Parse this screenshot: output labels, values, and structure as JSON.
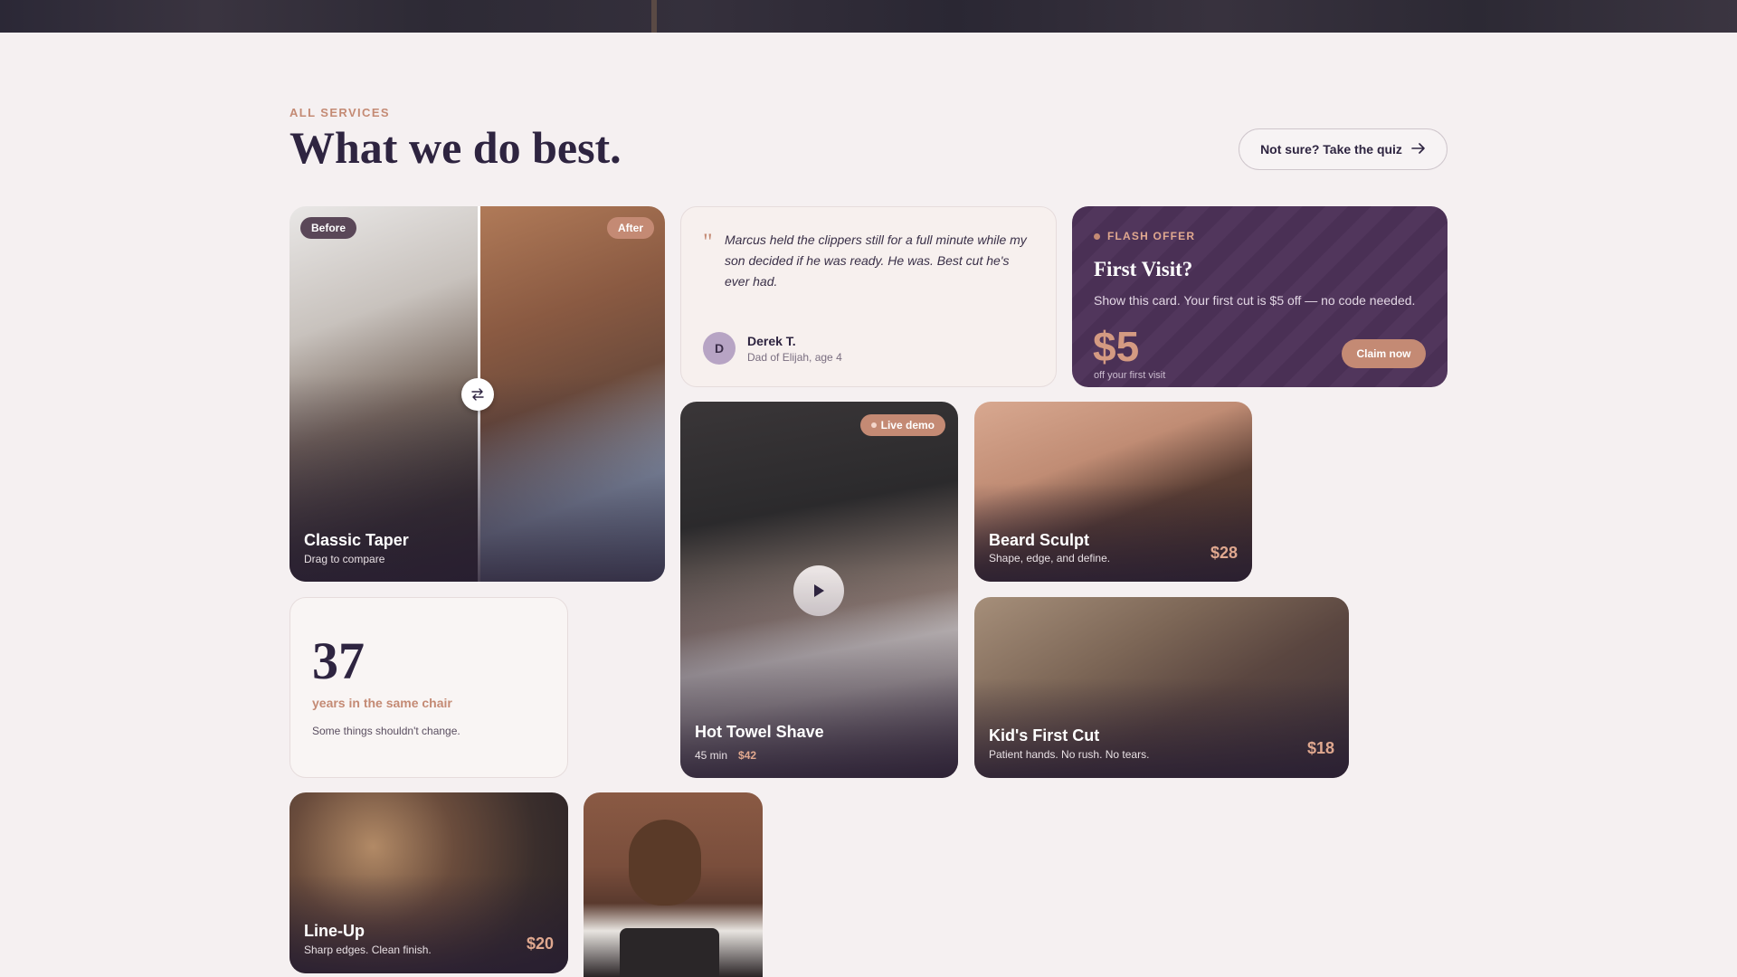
{
  "section": {
    "eyebrow": "ALL SERVICES",
    "title": "What we do best.",
    "quiz_button": "Not sure? Take the quiz",
    "quiz_icon": "arrow-right-icon"
  },
  "classic_taper": {
    "before_label": "Before",
    "after_label": "After",
    "title": "Classic Taper",
    "subtitle": "Drag to compare",
    "handle_icon": "swap-arrows-icon"
  },
  "testimonial": {
    "quote": "Marcus held the clippers still for a full minute while my son decided if he was ready. He was. Best cut he's ever had.",
    "avatar_initial": "D",
    "name": "Derek T.",
    "role": "Dad of Elijah, age 4"
  },
  "flash_offer": {
    "tag": "FLASH OFFER",
    "title": "First Visit?",
    "description": "Show this card. Your first cut is $5 off — no code needed.",
    "amount": "$5",
    "amount_sub": "off your first visit",
    "claim_button": "Claim now"
  },
  "hot_towel": {
    "badge": "Live demo",
    "title": "Hot Towel Shave",
    "duration": "45 min",
    "price": "$42",
    "play_icon": "play-icon"
  },
  "beard_sculpt": {
    "title": "Beard Sculpt",
    "subtitle": "Shape, edge, and define.",
    "price": "$28"
  },
  "stats": {
    "number": "37",
    "label": "years in the same chair",
    "sub": "Some things shouldn't change."
  },
  "kids_cut": {
    "title": "Kid's First Cut",
    "subtitle": "Patient hands. No rush. No tears.",
    "price": "$18"
  },
  "line_up": {
    "title": "Line-Up",
    "subtitle": "Sharp edges. Clean finish.",
    "price": "$20"
  },
  "colors": {
    "accent": "#c48a74",
    "ink": "#2e2440",
    "offer_bg": "#4a3055",
    "page_bg": "#f5f0f1"
  }
}
